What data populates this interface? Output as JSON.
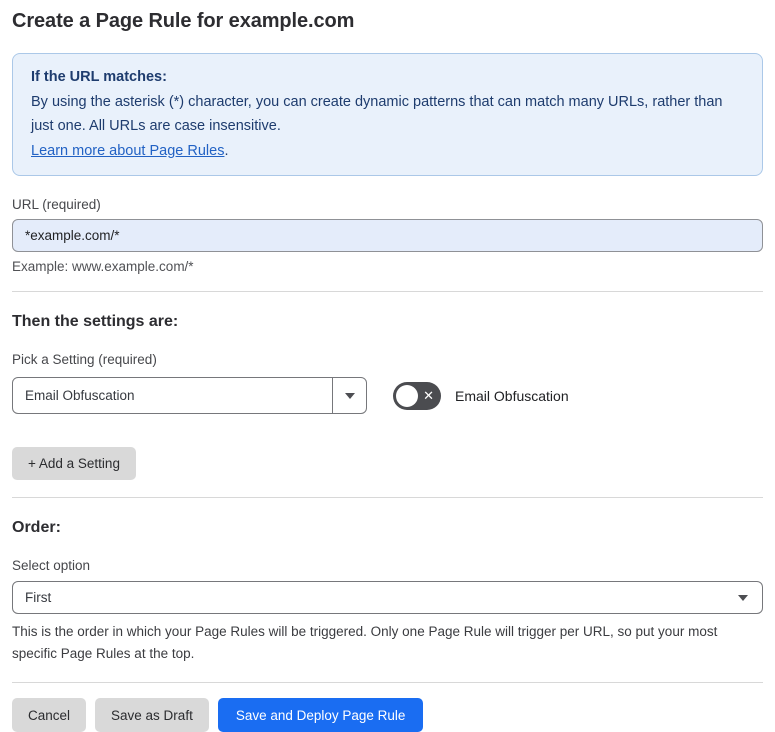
{
  "page": {
    "title": "Create a Page Rule for example.com"
  },
  "info_box": {
    "heading": "If the URL matches:",
    "body": "By using the asterisk (*) character, you can create dynamic patterns that can match many URLs, rather than just one. All URLs are case insensitive.",
    "link_label": "Learn more about Page Rules",
    "link_suffix": "."
  },
  "url_field": {
    "label": "URL (required)",
    "value": "*example.com/*",
    "helper": "Example: www.example.com/*"
  },
  "settings_section": {
    "heading": "Then the settings are:",
    "picker_label": "Pick a Setting (required)",
    "picker_value": "Email Obfuscation",
    "toggle_label": "Email Obfuscation",
    "toggle_state": "off",
    "toggle_glyph": "✕",
    "add_setting_label": "+ Add a Setting"
  },
  "order_section": {
    "heading": "Order:",
    "select_label": "Select option",
    "select_value": "First",
    "helper": "This is the order in which your Page Rules will be triggered. Only one Page Rule will trigger per URL, so put your most specific Page Rules at the top."
  },
  "footer": {
    "cancel_label": "Cancel",
    "save_draft_label": "Save as Draft",
    "save_deploy_label": "Save and Deploy Page Rule"
  },
  "colors": {
    "accent_blue": "#1a6df2",
    "info_background": "#e9f1fb",
    "info_border": "#abc8e8",
    "info_text": "#1e3c6e",
    "link_blue": "#2262c4",
    "url_input_background": "#e4ecfa",
    "toggle_off_background": "#4b4c50",
    "gray_button_background": "#d9d9d9"
  }
}
